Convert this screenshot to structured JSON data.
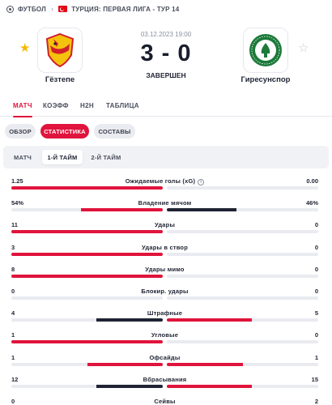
{
  "breadcrumb": {
    "sport": "ФУТБОЛ",
    "league": "ТУРЦИЯ: ПЕРВАЯ ЛИГА - ТУР 14"
  },
  "match": {
    "home": {
      "name": "Гёзтепе",
      "logo": "goztepe-logo"
    },
    "away": {
      "name": "Гиресунспор",
      "logo": "giresunspor-logo"
    },
    "date": "03.12.2023 19:00",
    "score": "3 - 0",
    "status": "ЗАВЕРШЕН"
  },
  "tabs": [
    "МАТЧ",
    "КОЭФФ",
    "H2H",
    "ТАБЛИЦА"
  ],
  "subtabs": [
    "ОБЗОР",
    "СТАТИСТИКА",
    "СОСТАВЫ"
  ],
  "periods": [
    "МАТЧ",
    "1-Й ТАЙМ",
    "2-Й ТАЙМ"
  ],
  "colors": {
    "accent": "#e0143c",
    "loser_bar": "#1f2333",
    "track": "#e9ebf0"
  },
  "stats": [
    {
      "name": "Ожидаемые голы (xG)",
      "home": "1.25",
      "away": "0.00",
      "home_share": 1.0,
      "away_share": 0.0,
      "home_leads": true,
      "info_icon": "info-icon"
    },
    {
      "name": "Владение мячом",
      "home": "54%",
      "away": "46%",
      "home_share": 0.54,
      "away_share": 0.46,
      "home_leads": true
    },
    {
      "name": "Удары",
      "home": "11",
      "away": "0",
      "home_share": 1.0,
      "away_share": 0.0,
      "home_leads": true
    },
    {
      "name": "Удары в створ",
      "home": "3",
      "away": "0",
      "home_share": 1.0,
      "away_share": 0.0,
      "home_leads": true
    },
    {
      "name": "Удары мимо",
      "home": "8",
      "away": "0",
      "home_share": 1.0,
      "away_share": 0.0,
      "home_leads": true
    },
    {
      "name": "Блокир. удары",
      "home": "0",
      "away": "0",
      "home_share": 0.0,
      "away_share": 0.0,
      "home_leads": false
    },
    {
      "name": "Штрафные",
      "home": "4",
      "away": "5",
      "home_share": 0.44,
      "away_share": 0.56,
      "home_leads": false
    },
    {
      "name": "Угловые",
      "home": "1",
      "away": "0",
      "home_share": 1.0,
      "away_share": 0.0,
      "home_leads": true
    },
    {
      "name": "Офсайды",
      "home": "1",
      "away": "1",
      "home_share": 0.5,
      "away_share": 0.5,
      "home_leads": null
    },
    {
      "name": "Вбрасывания",
      "home": "12",
      "away": "15",
      "home_share": 0.44,
      "away_share": 0.56,
      "home_leads": false
    },
    {
      "name": "Сейвы",
      "home": "0",
      "away": "2",
      "home_share": 0.0,
      "away_share": 1.0,
      "home_leads": false
    }
  ]
}
